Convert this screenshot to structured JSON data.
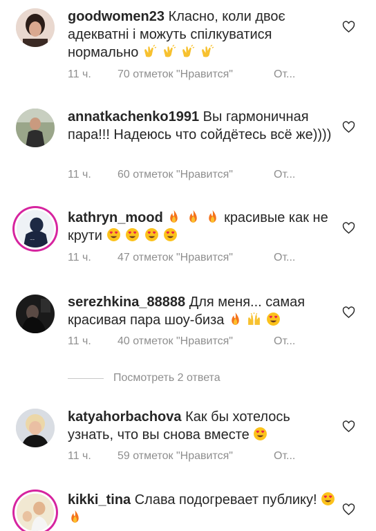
{
  "comments": [
    {
      "username": "goodwomen23",
      "text": "Класно, коли двоє адекватні  і можуть спілкуватися нормально",
      "emojis": [
        "clapping-hands-icon",
        "clapping-hands-icon",
        "clapping-hands-icon",
        "clapping-hands-icon"
      ],
      "time": "11 ч.",
      "likes": "70 отметок \"Нравится\"",
      "reply": "От..."
    },
    {
      "username": "annatkachenko1991",
      "text": "Вы гармоничная пара!!! Надеюсь что сойдётесь всё же))))",
      "emojis": [],
      "time": "11 ч.",
      "likes": "60 отметок \"Нравится\"",
      "reply": "От..."
    },
    {
      "username": "kathryn_mood",
      "text_before": "",
      "text": "красивые как не крути",
      "emojis_before": [
        "fire-icon",
        "fire-icon",
        "fire-icon"
      ],
      "emojis": [
        "heart-eyes-icon",
        "heart-eyes-icon",
        "heart-eyes-icon",
        "heart-eyes-icon"
      ],
      "time": "11 ч.",
      "likes": "47 отметок \"Нравится\"",
      "reply": "От..."
    },
    {
      "username": "serezhkina_88888",
      "text": "Для меня... самая красивая пара шоу-биза",
      "emojis": [
        "fire-icon",
        "raising-hands-icon",
        "heart-eyes-icon"
      ],
      "time": "11 ч.",
      "likes": "40 отметок \"Нравится\"",
      "reply": "От..."
    },
    {
      "username": "katyahorbachova",
      "text": "Как бы хотелось узнать, что вы снова вместе",
      "emojis": [
        "heart-eyes-icon"
      ],
      "time": "11 ч.",
      "likes": "59 отметок \"Нравится\"",
      "reply": "От..."
    },
    {
      "username": "kikki_tina",
      "text": "Слава подогревает публику!",
      "emojis": [
        "heart-eyes-icon",
        "fire-icon"
      ],
      "time": "",
      "likes": "",
      "reply": ""
    }
  ],
  "view_replies": "Посмотреть 2 ответа",
  "colors": {
    "text": "#262626",
    "meta": "#8e8e8e",
    "story_ring": "#d6249f"
  }
}
